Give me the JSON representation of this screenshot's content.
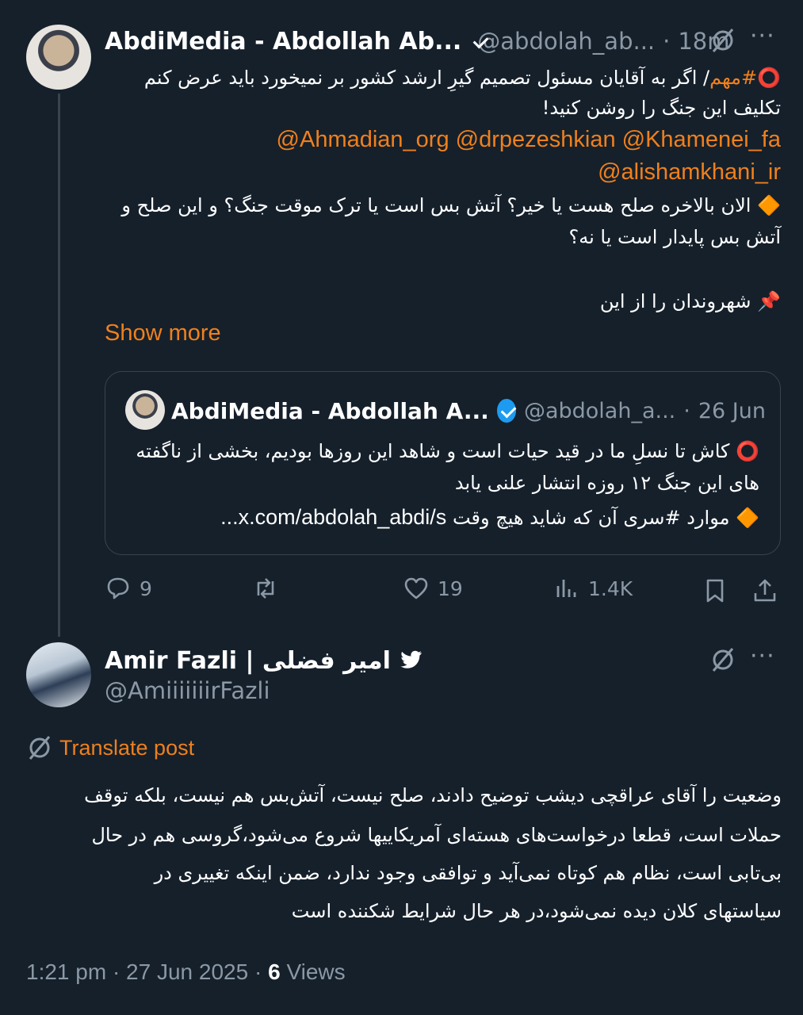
{
  "post": {
    "author_name": "AbdiMedia - Abdollah Ab...",
    "handle": "@abdolah_ab...",
    "separator": "·",
    "time": "18m",
    "line1_prefix": "⭕️",
    "line1_hashtag": "#مهم",
    "line1_rest": "/ اگر به آقایان مسئول تصمیم گیرِ ارشد کشور بر نمیخورد باید عرض کنم",
    "line2": "تکلیف این جنگ را روشن کنید!",
    "mentions_line1": "@Ahmadian_org @drpezeshkian @Khamenei_fa",
    "mentions_line2": "@alishamkhani_ir",
    "question_bullet": "🔶",
    "question_line1": "الان بالاخره صلح هست یا خیر؟ آتش بس است یا ترک موقت جنگ؟ و این صلح و",
    "question_line2": "آتش بس پایدار است یا نه؟",
    "pin_emoji": "📌",
    "pin_text": "شهروندان را از این",
    "show_more": "Show more"
  },
  "quote": {
    "author_name": "AbdiMedia - Abdollah A...",
    "handle": "@abdolah_a...",
    "separator": "·",
    "date": "26 Jun",
    "line1_prefix": "⭕️",
    "line1": "کاش تا نسلِ ما در قید حیات است و شاهد این روزها بودیم، بخشی از ناگفته",
    "line2": "های این جنگ ۱۲ روزه انتشار علنی یابد",
    "line3_bullet": "🔶",
    "line3_text": "موارد #سری آن که شاید هیچ وقت",
    "line3_link": "x.com/abdolah_abdi/s..."
  },
  "actions": {
    "replies": "9",
    "retweets": "",
    "likes": "19",
    "views": "1.4K"
  },
  "reply": {
    "author_name": "Amir Fazli | امیر فضلی",
    "handle": "@AmiiiiiiirFazli",
    "translate": "Translate post",
    "body_line1": "وضعیت را آقای عراقچی دیشب توضیح دادند، صلح نیست، آتش‌بس هم نیست، بلکه توقف",
    "body_line2": "حملات است، قطعا درخواست‌های هسته‌ای آمریکاییها شروع می‌شود،گروسی هم در حال",
    "body_line3": "بی‌تابی است، نظام هم کوتاه نمی‌آید و توافقی وجود ندارد، ضمن اینکه تغییری در",
    "body_line4": "سیاستهای کلان دیده نمی‌شود،در هر حال شرایط شکننده است",
    "timestamp": "1:21 pm · 27 Jun 2025 ·",
    "views_count": "6",
    "views_label": "Views"
  },
  "colors": {
    "background": "#15202b",
    "accent": "#f0801c",
    "muted": "#8b98a5",
    "verified": "#1d9bf0",
    "border": "#38444d"
  }
}
